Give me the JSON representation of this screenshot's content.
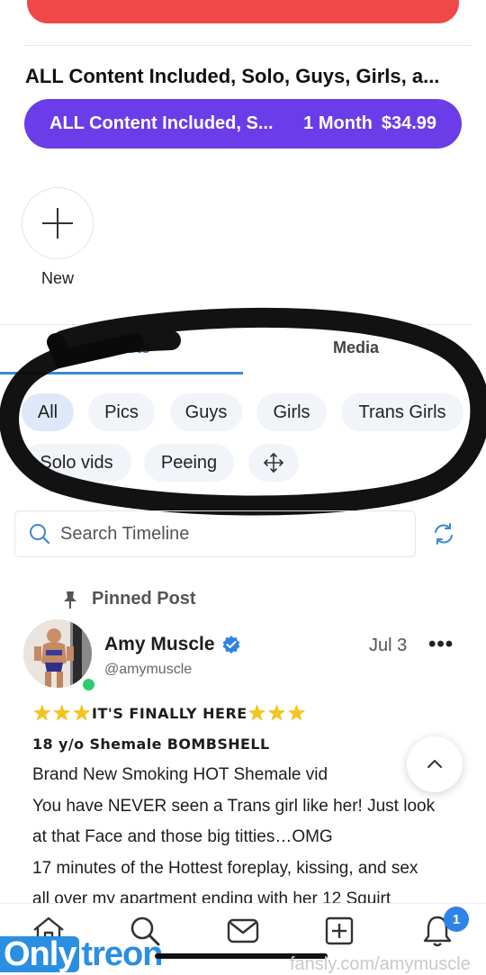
{
  "subscription": {
    "title": "ALL Content Included, Solo, Guys, Girls, a...",
    "button_label": "ALL Content Included, S...",
    "button_period": "1 Month",
    "button_price": "$34.99"
  },
  "new_story": {
    "label": "New"
  },
  "tabs": [
    {
      "label": "Posts"
    },
    {
      "label": "Media"
    }
  ],
  "filters": [
    {
      "label": "All"
    },
    {
      "label": "Pics"
    },
    {
      "label": "Guys"
    },
    {
      "label": "Girls"
    },
    {
      "label": "Trans Girls"
    },
    {
      "label": "Solo vids"
    },
    {
      "label": "Peeing"
    }
  ],
  "search": {
    "placeholder": "Search Timeline"
  },
  "pinned": {
    "label": "Pinned Post"
  },
  "post": {
    "author_name": "Amy Muscle",
    "author_handle": "@amymuscle",
    "date": "Jul 3",
    "more": "•••",
    "headline": "IT'S FINALLY HERE",
    "subheadline": "18 y/o Shemale BOMBSHELL",
    "lines": [
      "Brand New Smoking HOT Shemale vid",
      "You have NEVER seen a Trans girl like her! Just look",
      "at that Face and those big titties…OMG",
      "17 minutes of the Hottest foreplay, kissing, and sex",
      "all over my apartment ending with her 12 Squirt"
    ]
  },
  "notifications": {
    "badge": "1"
  },
  "watermark": {
    "part1": "Only",
    "part2": "treon",
    "url": "fansly.com/amymuscle"
  },
  "colors": {
    "accent": "#6a3de8",
    "link": "#3b88d6",
    "danger": "#f04848",
    "badge": "#2f82e8"
  }
}
